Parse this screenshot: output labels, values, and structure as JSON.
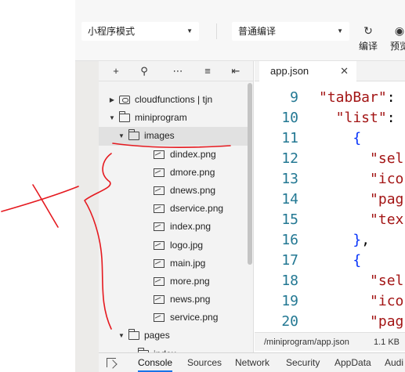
{
  "toolbar": {
    "mode_select": "小程序模式",
    "compile_select": "普通编译",
    "compile_button": "编译",
    "preview_button": "预览"
  },
  "explorer": {
    "tree": [
      {
        "label": "cloudfunctions | tjn",
        "type": "cloud-folder",
        "expanded": false,
        "depth": 0
      },
      {
        "label": "miniprogram",
        "type": "folder",
        "expanded": true,
        "depth": 0
      },
      {
        "label": "images",
        "type": "folder",
        "expanded": true,
        "depth": 1,
        "selected": true
      },
      {
        "label": "dindex.png",
        "type": "image",
        "depth": 2
      },
      {
        "label": "dmore.png",
        "type": "image",
        "depth": 2
      },
      {
        "label": "dnews.png",
        "type": "image",
        "depth": 2
      },
      {
        "label": "dservice.png",
        "type": "image",
        "depth": 2
      },
      {
        "label": "index.png",
        "type": "image",
        "depth": 2
      },
      {
        "label": "logo.jpg",
        "type": "image",
        "depth": 2
      },
      {
        "label": "main.jpg",
        "type": "image",
        "depth": 2
      },
      {
        "label": "more.png",
        "type": "image",
        "depth": 2
      },
      {
        "label": "news.png",
        "type": "image",
        "depth": 2
      },
      {
        "label": "service.png",
        "type": "image",
        "depth": 2
      },
      {
        "label": "pages",
        "type": "folder",
        "expanded": true,
        "depth": 1
      },
      {
        "label": "index",
        "type": "folder",
        "expanded": false,
        "depth": 2
      }
    ]
  },
  "editor": {
    "tab_label": "app.json",
    "lines": [
      {
        "n": "9",
        "parts": [
          {
            "t": "\"tabBar\"",
            "c": "key"
          },
          {
            "t": ":",
            "c": "plain"
          }
        ]
      },
      {
        "n": "10",
        "parts": [
          {
            "t": "  \"list\"",
            "c": "key"
          },
          {
            "t": ":",
            "c": "plain"
          }
        ]
      },
      {
        "n": "11",
        "parts": [
          {
            "t": "    {",
            "c": "punc"
          }
        ]
      },
      {
        "n": "12",
        "parts": [
          {
            "t": "      \"sel",
            "c": "key"
          }
        ]
      },
      {
        "n": "13",
        "parts": [
          {
            "t": "      \"ico",
            "c": "key"
          }
        ]
      },
      {
        "n": "14",
        "parts": [
          {
            "t": "      \"pag",
            "c": "key"
          }
        ]
      },
      {
        "n": "15",
        "parts": [
          {
            "t": "      \"tex",
            "c": "key"
          }
        ]
      },
      {
        "n": "16",
        "parts": [
          {
            "t": "    }",
            "c": "punc"
          },
          {
            "t": ",",
            "c": "plain"
          }
        ]
      },
      {
        "n": "17",
        "parts": [
          {
            "t": "    {",
            "c": "punc"
          }
        ]
      },
      {
        "n": "18",
        "parts": [
          {
            "t": "      \"sel",
            "c": "key"
          }
        ]
      },
      {
        "n": "19",
        "parts": [
          {
            "t": "      \"ico",
            "c": "key"
          }
        ]
      },
      {
        "n": "20",
        "parts": [
          {
            "t": "      \"pag",
            "c": "key"
          }
        ]
      }
    ]
  },
  "status": {
    "path": "/miniprogram/app.json",
    "size": "1.1 KB"
  },
  "devtools": {
    "tabs": [
      "Console",
      "Sources",
      "Network",
      "Security",
      "AppData",
      "Audi"
    ]
  },
  "colors": {
    "annotation": "#e5191f",
    "line_number": "#237893",
    "json_key": "#a31515",
    "brace": "#0431fa"
  }
}
